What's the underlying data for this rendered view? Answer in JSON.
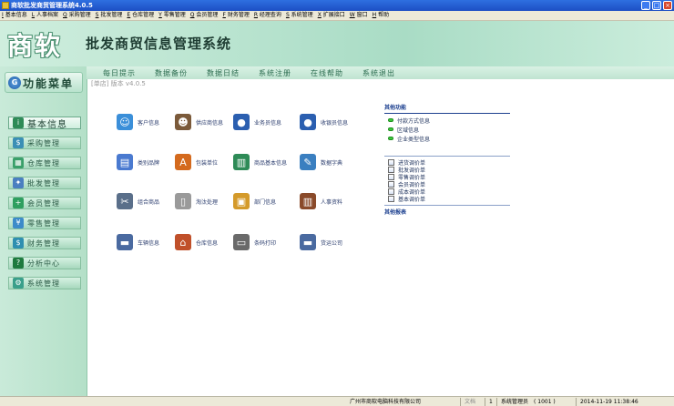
{
  "window": {
    "title": "商软批发商贸管理系统4.0.5"
  },
  "menu": [
    {
      "key": "I",
      "label": "基本信息"
    },
    {
      "key": "L",
      "label": "人事档案"
    },
    {
      "key": "Q",
      "label": "采购管理"
    },
    {
      "key": "S",
      "label": "批发管理"
    },
    {
      "key": "E",
      "label": "仓库管理"
    },
    {
      "key": "Y",
      "label": "零售管理"
    },
    {
      "key": "Q",
      "label": "会员管理"
    },
    {
      "key": "F",
      "label": "财务管理"
    },
    {
      "key": "R",
      "label": "经理查询"
    },
    {
      "key": "S",
      "label": "系统管理"
    },
    {
      "key": "X",
      "label": "扩展接口"
    },
    {
      "key": "W",
      "label": "窗口"
    },
    {
      "key": "H",
      "label": "帮助"
    }
  ],
  "banner": {
    "logo": "商软",
    "subtitle": "批发商贸信息管理系统"
  },
  "toolbar": [
    "每日提示",
    "数据备份",
    "数据日结",
    "系统注册",
    "在线帮助",
    "系统退出"
  ],
  "sidebar": {
    "header": "功能菜单",
    "items": [
      {
        "label": "基本信息",
        "icon": "info-icon",
        "color": "#2e8b57",
        "active": true
      },
      {
        "label": "采购管理",
        "icon": "cart-icon",
        "color": "#3b8fb5"
      },
      {
        "label": "仓库管理",
        "icon": "warehouse-icon",
        "color": "#3aa06a"
      },
      {
        "label": "批发管理",
        "icon": "wholesale-icon",
        "color": "#4a7fc0"
      },
      {
        "label": "会员管理",
        "icon": "member-icon",
        "color": "#2f9f5f"
      },
      {
        "label": "零售管理",
        "icon": "retail-icon",
        "color": "#3d8bc9"
      },
      {
        "label": "财务管理",
        "icon": "finance-icon",
        "color": "#2f8fb0"
      },
      {
        "label": "分析中心",
        "icon": "help-icon",
        "color": "#1e7a3e"
      },
      {
        "label": "系统管理",
        "icon": "settings-icon",
        "color": "#3a9f8a"
      }
    ]
  },
  "content": {
    "shop_version": "[单店] 版本 v4.0.5",
    "tiles": [
      {
        "label": "客户信息",
        "icon": "customers-icon",
        "color": "#3b8fd9"
      },
      {
        "label": "供应商信息",
        "icon": "supplier-icon",
        "color": "#7b5a3a"
      },
      {
        "label": "业务员信息",
        "icon": "salesman-icon",
        "color": "#2b5fb0"
      },
      {
        "label": "收银员信息",
        "icon": "cashier-icon",
        "color": "#2b5fb0"
      },
      {
        "label": "类别品牌",
        "icon": "brand-icon",
        "color": "#4a7ad0"
      },
      {
        "label": "包装单位",
        "icon": "abc-icon",
        "color": "#d46a1e"
      },
      {
        "label": "商品基本信息",
        "icon": "books-icon",
        "color": "#2e8b57"
      },
      {
        "label": "数据字典",
        "icon": "dictionary-icon",
        "color": "#3a7fc0"
      },
      {
        "label": "组合商品",
        "icon": "tools-icon",
        "color": "#5a6f8a"
      },
      {
        "label": "淘汰处理",
        "icon": "trash-icon",
        "color": "#9a9a9a"
      },
      {
        "label": "部门信息",
        "icon": "factory-icon",
        "color": "#d49a2a"
      },
      {
        "label": "人事资料",
        "icon": "files-icon",
        "color": "#8a4a2a"
      },
      {
        "label": "车辆信息",
        "icon": "vehicle-icon",
        "color": "#4a6aa0"
      },
      {
        "label": "仓库信息",
        "icon": "house-icon",
        "color": "#c0502a"
      },
      {
        "label": "条码打印",
        "icon": "printer-icon",
        "color": "#6a6a6a"
      },
      {
        "label": "货运公司",
        "icon": "truck-icon",
        "color": "#4a6aa0"
      }
    ],
    "right_panel": {
      "other_functions_title": "其他功能",
      "other_functions": [
        "付款方式信息",
        "区域信息",
        "企业类型信息"
      ],
      "price_docs": [
        "进货调价单",
        "批发调价单",
        "零售调价单",
        "会员调价单",
        "成本调价单",
        "基本调价单"
      ],
      "other_reports_title": "其他报表"
    }
  },
  "status": {
    "company": "广州市商软电脑科技有限公司",
    "doc": "文档",
    "num": "1",
    "user": "系统管理员",
    "user_code": "( 1001 )",
    "datetime": "2014-11-19 11:38:46"
  }
}
